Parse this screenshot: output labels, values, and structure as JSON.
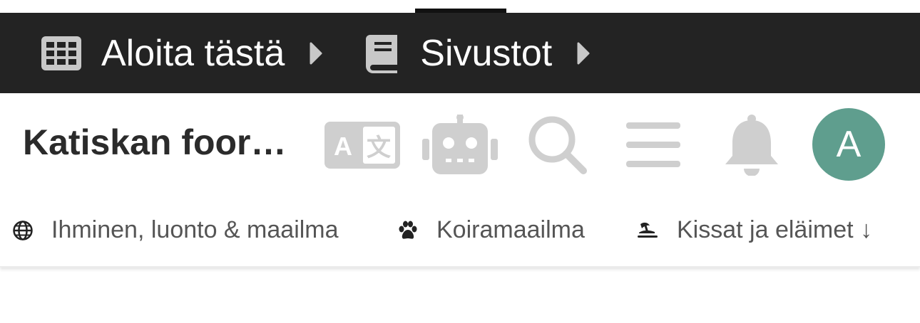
{
  "breadcrumbs": [
    {
      "label": "Aloita tästä",
      "icon": "grid-icon"
    },
    {
      "label": "Sivustot",
      "icon": "book-icon"
    }
  ],
  "header": {
    "site_title": "Katiskan foor…",
    "icons": [
      "translate-icon",
      "robot-icon",
      "search-icon",
      "menu-icon",
      "bell-icon"
    ],
    "avatar_letter": "A",
    "avatar_color": "#5f9e8e"
  },
  "categories": [
    {
      "label": "Ihminen, luonto & maailma",
      "icon": "globe-icon"
    },
    {
      "label": "Koiramaailma",
      "icon": "paw-icon"
    },
    {
      "label": "Kissat ja eläimet ↓",
      "icon": "island-icon"
    }
  ],
  "colors": {
    "top_bar": "#232323",
    "icon_gray": "#cfcfcf",
    "text_dark": "#2b2b2b"
  }
}
